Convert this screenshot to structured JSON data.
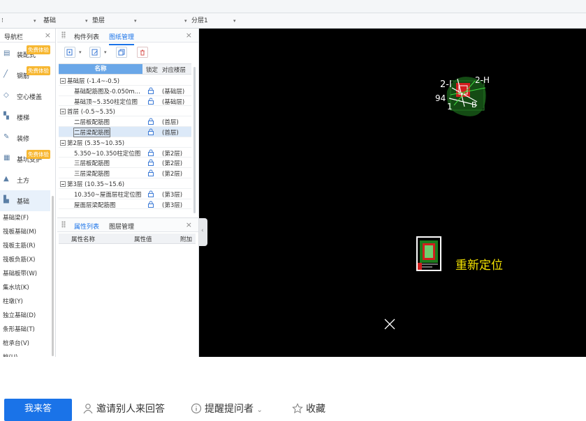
{
  "floorbar": {
    "sel1": "基础",
    "sel2": "垫层",
    "sel3": "分层1"
  },
  "nav": {
    "title": "导航栏",
    "items": [
      {
        "label": "装配式",
        "badge": "免费体验"
      },
      {
        "label": "钢筋",
        "badge": "免费体验"
      },
      {
        "label": "空心楼盖",
        "badge": ""
      },
      {
        "label": "楼梯",
        "badge": ""
      },
      {
        "label": "装修",
        "badge": ""
      },
      {
        "label": "基坑支护",
        "badge": "免费体验"
      },
      {
        "label": "土方",
        "badge": ""
      },
      {
        "label": "基础",
        "badge": ""
      }
    ],
    "sub_items": [
      "基础梁(F)",
      "筏板基础(M)",
      "筏板主筋(R)",
      "筏板负筋(X)",
      "基础板带(W)",
      "集水坑(K)",
      "柱墩(Y)",
      "独立基础(D)",
      "条形基础(T)",
      "桩承台(V)",
      "桩(U)"
    ]
  },
  "panel": {
    "tab1": "构件列表",
    "tab2": "图纸管理",
    "col_name": "名称",
    "col_lock": "锁定",
    "col_floor": "对应楼层",
    "groups": [
      {
        "title": "基础层 (-1.4~-0.5)",
        "rows": [
          {
            "name": "基础配筋图及-0.050m...",
            "floor": "(基础层)",
            "locked": true
          },
          {
            "name": "基础顶~5.350柱定位图",
            "floor": "(基础层)",
            "locked": false
          }
        ]
      },
      {
        "title": "首层 (-0.5~5.35)",
        "rows": [
          {
            "name": "二层板配筋图",
            "floor": "(首层)",
            "locked": true
          },
          {
            "name": "二层梁配筋图",
            "floor": "(首层)",
            "locked": true,
            "selected": true
          }
        ]
      },
      {
        "title": "第2层 (5.35~10.35)",
        "rows": [
          {
            "name": "5.350~10.350柱定位图",
            "floor": "(第2层)",
            "locked": true
          },
          {
            "name": "三层板配筋图",
            "floor": "(第2层)",
            "locked": true
          },
          {
            "name": "三层梁配筋图",
            "floor": "(第2层)",
            "locked": true
          }
        ]
      },
      {
        "title": "第3层 (10.35~15.6)",
        "rows": [
          {
            "name": "10.350~屋面层柱定位图",
            "floor": "(第3层)",
            "locked": true
          },
          {
            "name": "屋面层梁配筋图",
            "floor": "(第3层)",
            "locked": true
          }
        ]
      }
    ]
  },
  "prop": {
    "tab1": "属性列表",
    "tab2": "图层管理",
    "col1": "属性名称",
    "col2": "属性值",
    "col3": "附加"
  },
  "canvas": {
    "reloc_label": "重新定位",
    "accent": "#f5e400",
    "bg": "#000000"
  },
  "footer": {
    "answer": "我来答",
    "invite": "邀请别人来回答",
    "remind": "提醒提问者",
    "collect": "收藏",
    "accent": "#1a73e8"
  }
}
